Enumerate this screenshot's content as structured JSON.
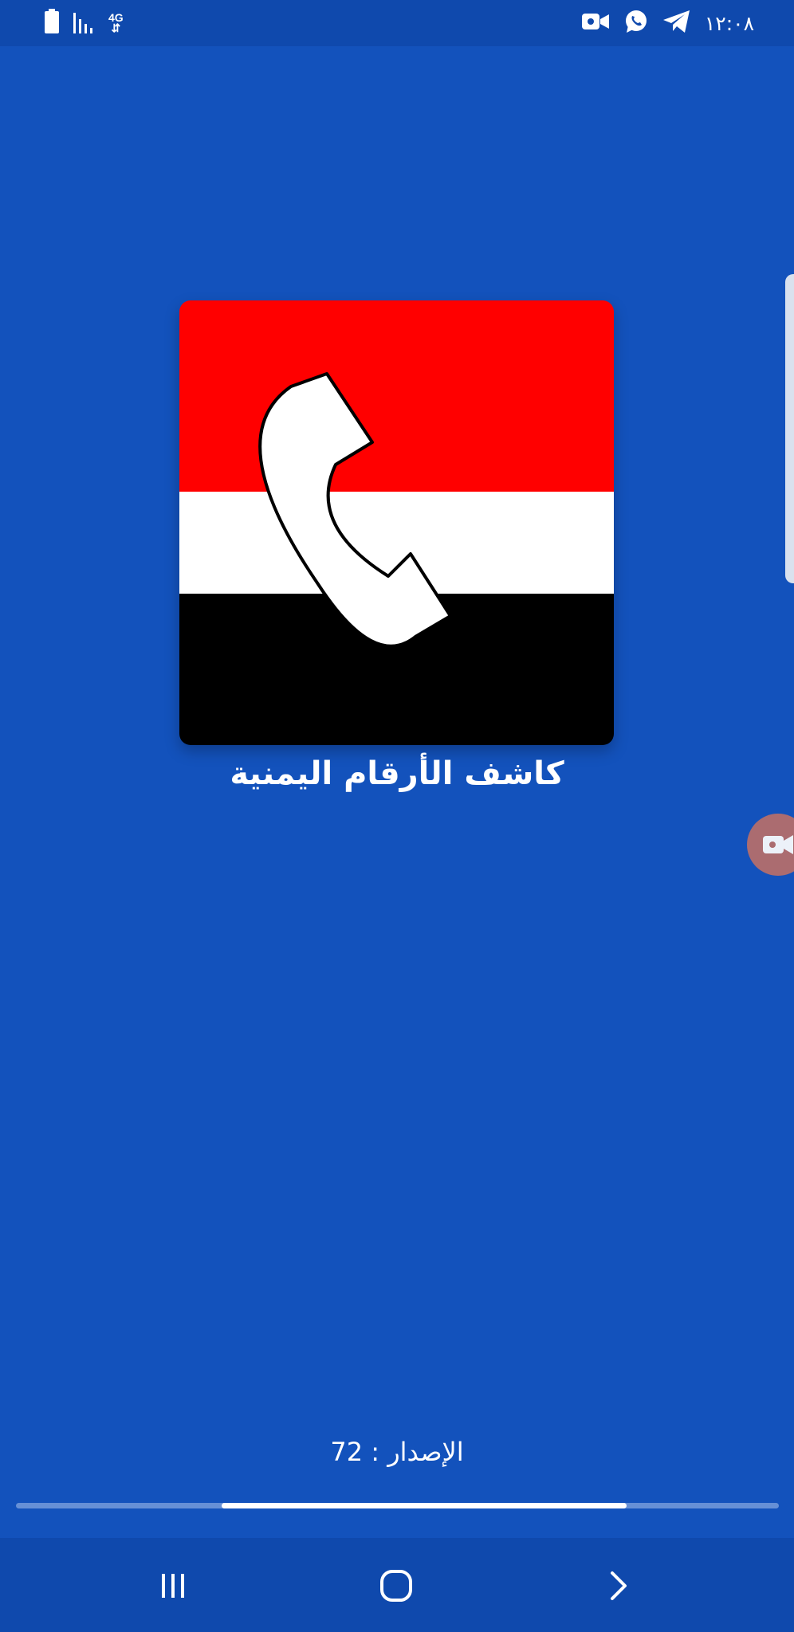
{
  "status_bar": {
    "time": "١٢:٠٨",
    "network_label_top": "4G",
    "network_label_bottom": "⇵",
    "left_icons": [
      "battery-icon",
      "signal-icon",
      "network-4g-icon"
    ],
    "right_icons": [
      "video-camera-icon",
      "whatsapp-icon",
      "telegram-icon"
    ]
  },
  "splash": {
    "logo_icon": "yemen-flag-phone-logo",
    "app_name": "كاشف الأرقام اليمنية",
    "version_text": "الإصدار : 72",
    "progress": {
      "start": 0.27,
      "end": 0.8
    }
  },
  "overlays": {
    "floating_button_icon": "screen-record-icon"
  },
  "nav_bar": {
    "buttons": [
      "recent-apps-icon",
      "home-icon",
      "back-icon"
    ]
  },
  "colors": {
    "background": "#1352bc",
    "bars": "#0f49ad",
    "flag_red": "#ff0000",
    "flag_white": "#ffffff",
    "flag_black": "#000000",
    "progress_fill": "#ffffff",
    "progress_track": "#6690d6"
  }
}
